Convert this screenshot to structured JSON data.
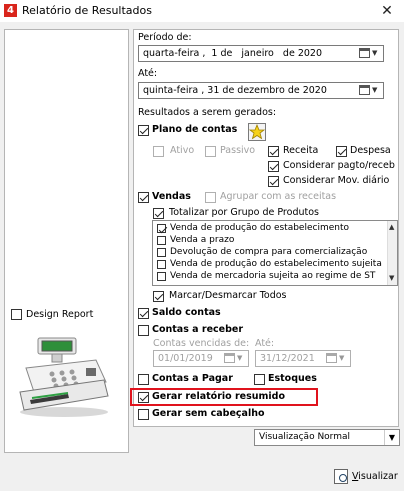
{
  "window": {
    "title": "Relatório de Resultados",
    "close_glyph": "✕",
    "app_icon_glyph": "4"
  },
  "left": {
    "design_report_label": "Design Report"
  },
  "periodo": {
    "label": "Período de:",
    "value": "quarta-feira ,  1 de   janeiro   de 2020"
  },
  "ate": {
    "label": "Até:",
    "value": "quinta-feira , 31 de dezembro de 2020"
  },
  "resultados_label": "Resultados a serem gerados:",
  "plano": {
    "label": "Plano de contas",
    "ativo": "Ativo",
    "passivo": "Passivo",
    "receita": "Receita",
    "despesa": "Despesa",
    "considerar_pagto": "Considerar pagto/receb",
    "considerar_mov": "Considerar Mov. diário"
  },
  "vendas": {
    "label": "Vendas",
    "agrupar": "Agrupar com as receitas",
    "totalizar": "Totalizar por Grupo de Produtos",
    "items": [
      "Venda de produção do estabelecimento",
      "Venda a prazo",
      "Devolução de compra para comercialização",
      "Venda de produção do estabelecimento sujeita",
      "Venda de mercadoria sujeita ao regime de ST"
    ],
    "marcar": "Marcar/Desmarcar Todos"
  },
  "saldo_contas": "Saldo contas",
  "contas_receber": {
    "label": "Contas a receber",
    "vencidas_label": "Contas vencidas de:",
    "ate_label": "Até:",
    "from": "01/01/2019",
    "to": "31/12/2021"
  },
  "contas_pagar": "Contas a Pagar",
  "estoques": "Estoques",
  "gerar_resumido": "Gerar relatório resumido",
  "gerar_sem_cabecalho": "Gerar sem cabeçalho",
  "visualizacao": {
    "selected": "Visualização Normal"
  },
  "visualizar_button": {
    "underlined": "V",
    "rest": "isualizar"
  },
  "colors": {
    "highlight": "#e0131d",
    "app_icon": "#d9251c"
  }
}
